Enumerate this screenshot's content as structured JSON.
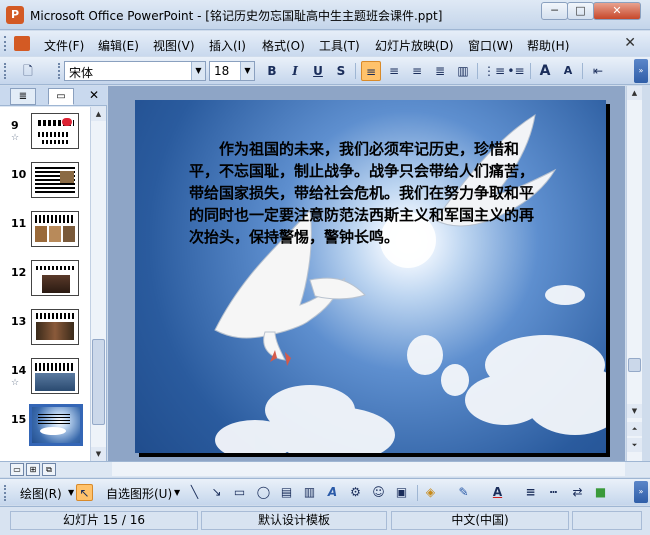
{
  "window": {
    "app_icon": "P",
    "title": "Microsoft Office PowerPoint - [铭记历史勿忘国耻高中生主题班会课件.ppt]",
    "minimize": "─",
    "maximize": "□",
    "close": "✕"
  },
  "menu": {
    "items": [
      "文件(F)",
      "编辑(E)",
      "视图(V)",
      "插入(I)",
      "格式(O)",
      "工具(T)",
      "幻灯片放映(D)",
      "窗口(W)",
      "帮助(H)"
    ],
    "close": "✕"
  },
  "format_toolbar": {
    "new": "🗋",
    "font_name": "宋体",
    "font_size": "18",
    "bold": "B",
    "italic": "I",
    "underline": "U",
    "shadow": "S",
    "align_left": "≡",
    "center": "≡",
    "align_right": "≡",
    "distribute": "≣",
    "columns": "▥",
    "numbering": "⋮≡",
    "bullets": "•≡",
    "grow_font": "A",
    "shrink_font": "A",
    "decrease_indent": "⇤",
    "chevron": "»"
  },
  "outline_pane": {
    "tab_outline": "≣",
    "tab_slides": "▭",
    "close": "✕",
    "slides": [
      {
        "num": "9",
        "star": "☆"
      },
      {
        "num": "10",
        "star": ""
      },
      {
        "num": "11",
        "star": ""
      },
      {
        "num": "12",
        "star": ""
      },
      {
        "num": "13",
        "star": ""
      },
      {
        "num": "14",
        "star": "☆"
      },
      {
        "num": "15",
        "star": ""
      }
    ]
  },
  "slide": {
    "body_text": "作为祖国的未来，我们必须牢记历史，珍惜和平，不忘国耻，制止战争。战争只会带给人们痛苦，带给国家损失，带给社会危机。我们在努力争取和平的同时也一定要注意防范法西斯主义和军国主义的再次抬头，保持警惕，警钟长鸣。"
  },
  "view_buttons": {
    "normal": "▭",
    "sorter": "⊞",
    "show": "⧉"
  },
  "draw_toolbar": {
    "draw_label": "绘图(R)",
    "autoshapes_label": "自选图形(U)",
    "select": "↖",
    "line": "╲",
    "arrow": "↘",
    "rectangle": "▭",
    "oval": "◯",
    "textbox": "▤",
    "vertical_textbox": "▥",
    "wordart": "A",
    "diagram": "⚙",
    "clipart": "☺",
    "picture": "▣",
    "fill_color": "◈",
    "line_color": "✎",
    "font_color": "A",
    "line_style": "≡",
    "dash_style": "┅",
    "arrow_style": "⇄",
    "shadow_3d": "■"
  },
  "status": {
    "slide_position": "幻灯片 15 / 16",
    "design_template": "默认设计模板",
    "language": "中文(中国)"
  },
  "colors": {
    "accent_orange": "#ffc26b",
    "toolbar_blue": "#c5d6ec",
    "slide_sky": "#2a5b9e"
  }
}
